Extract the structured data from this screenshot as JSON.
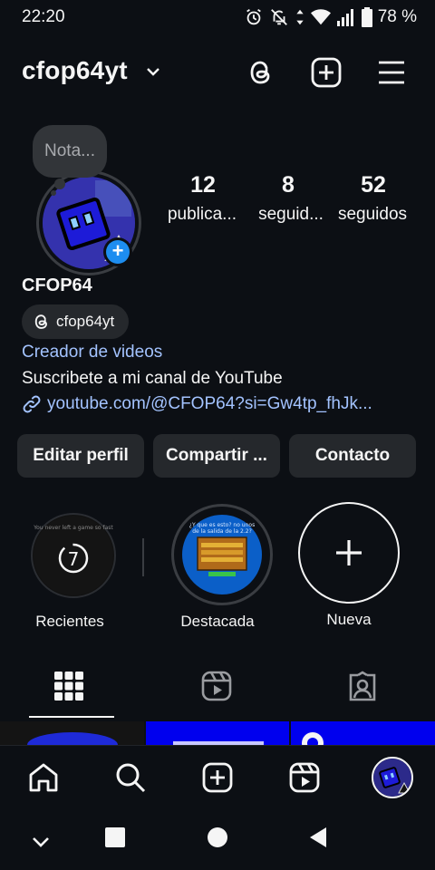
{
  "status_bar": {
    "time": "22:20",
    "battery": "78 %",
    "icons": [
      "alarm-icon",
      "bell-off-icon",
      "data-arrows-icon",
      "wifi-icon",
      "signal-icon",
      "battery-icon"
    ]
  },
  "header": {
    "username": "cfop64yt",
    "icons": [
      "chevron-down-icon",
      "threads-icon",
      "create-icon",
      "menu-icon"
    ]
  },
  "note": {
    "placeholder": "Nota..."
  },
  "stats": [
    {
      "value": "12",
      "label": "publica..."
    },
    {
      "value": "8",
      "label": "seguid..."
    },
    {
      "value": "52",
      "label": "seguidos"
    }
  ],
  "profile": {
    "display_name": "CFOP64",
    "threads_handle": "cfop64yt",
    "category": "Creador de videos",
    "bio": "Suscribete a mi canal de YouTube",
    "link": "youtube.com/@CFOP64?si=Gw4tp_fhJk..."
  },
  "buttons": {
    "edit": "Editar perfil",
    "share": "Compartir ...",
    "contact": "Contacto"
  },
  "highlights": [
    {
      "label": "Recientes",
      "badge": "7"
    },
    {
      "label": "Destacada"
    },
    {
      "label": "Nueva"
    }
  ],
  "tabs": [
    "grid-icon",
    "reels-icon",
    "tagged-icon"
  ],
  "bottom_nav": [
    "home-icon",
    "search-icon",
    "create-icon",
    "reels-icon",
    "profile-avatar"
  ],
  "colors": {
    "background": "#0c0f14",
    "button_bg": "#25282c",
    "link": "#a3c3ff",
    "badge_blue": "#1d8df0"
  }
}
